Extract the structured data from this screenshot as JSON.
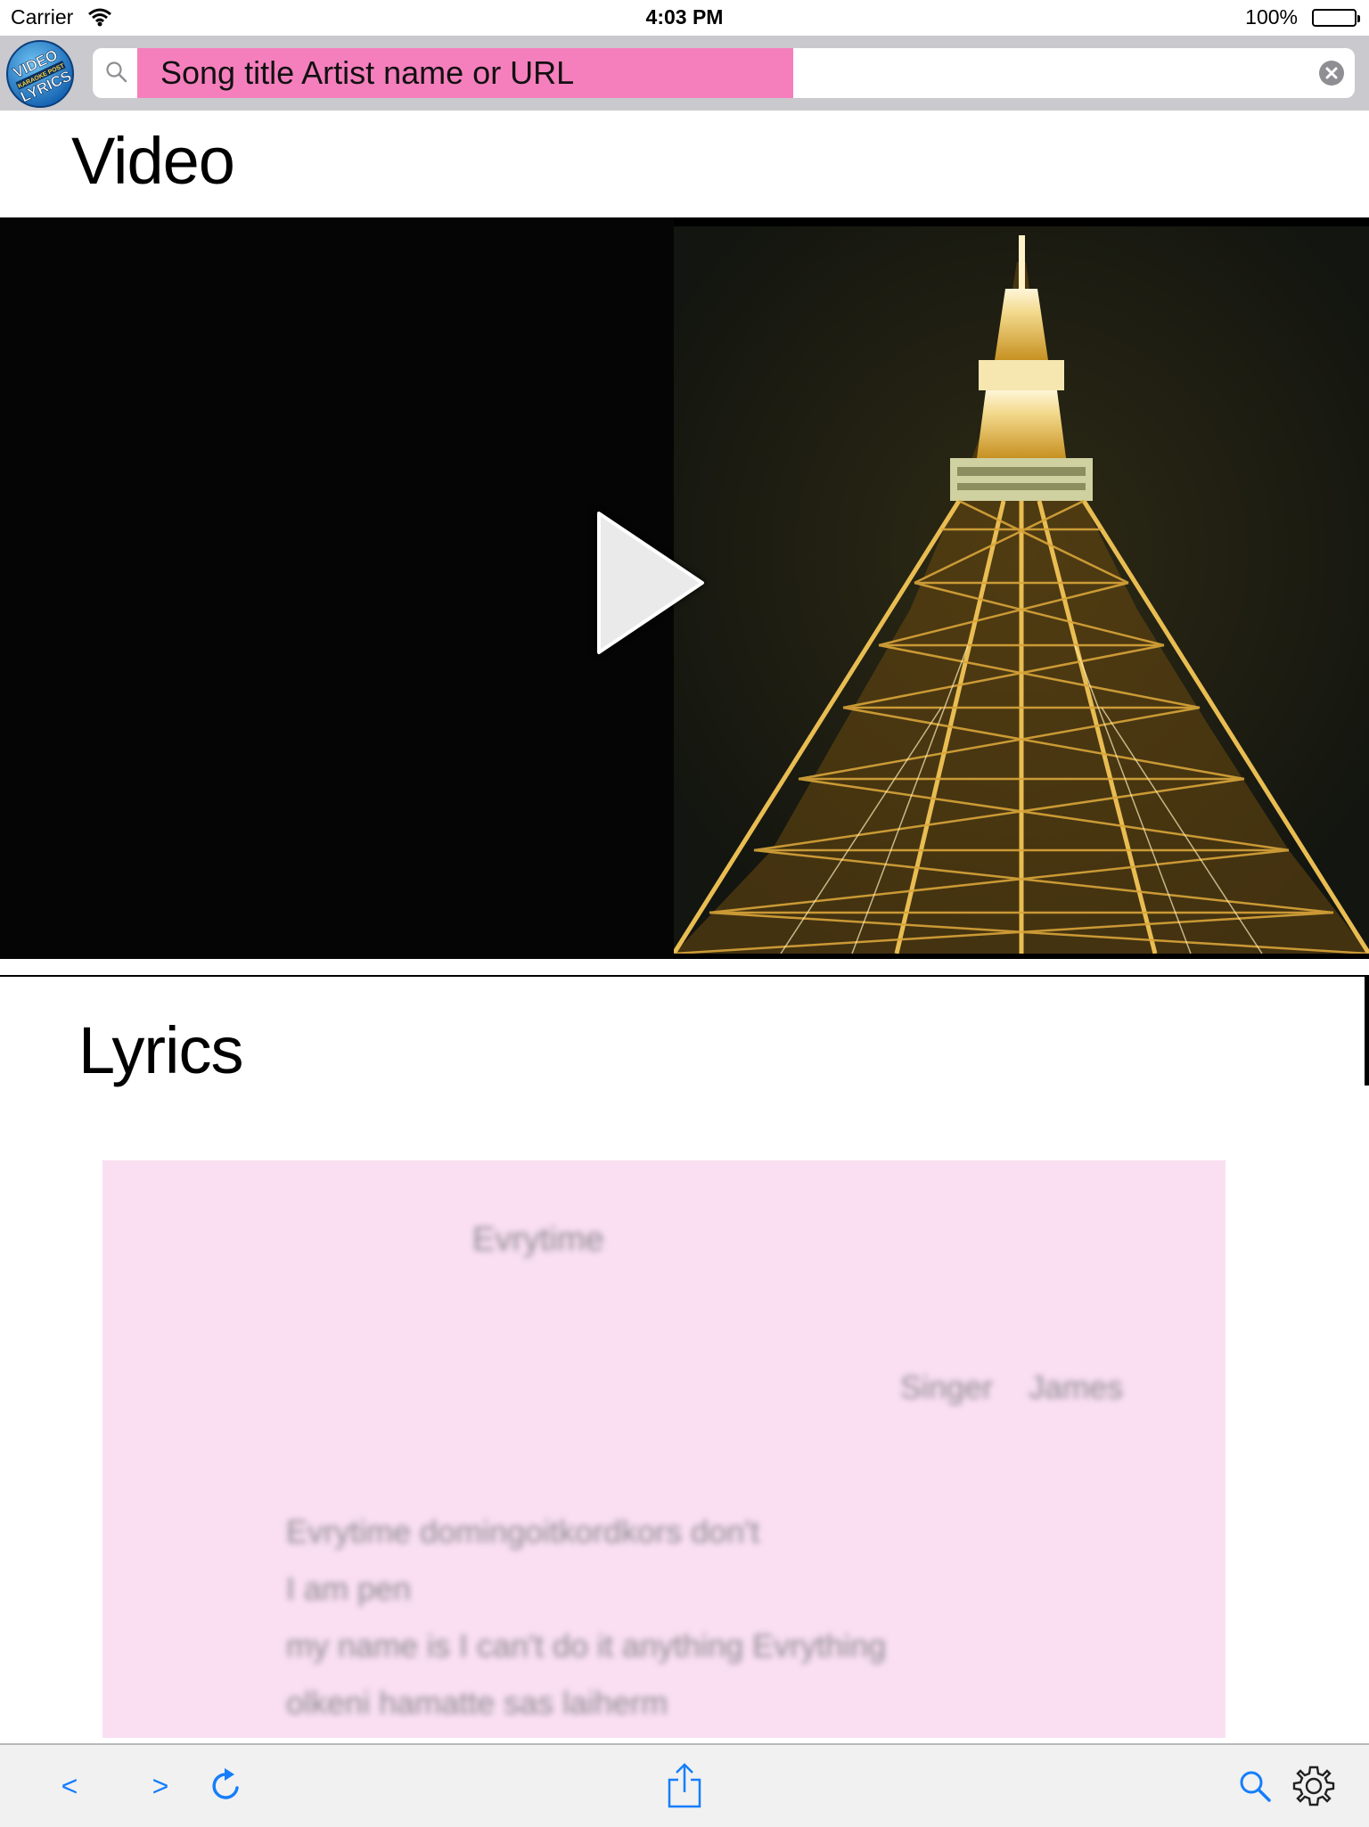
{
  "status_bar": {
    "carrier": "Carrier",
    "time": "4:03 PM",
    "battery": "100%"
  },
  "search": {
    "logo_top": "VIDEO",
    "logo_middle": "KARAOKE POST",
    "logo_bottom": "LYRICS",
    "placeholder": "Song title Artist name or URL"
  },
  "sections": {
    "video_heading": "Video",
    "lyrics_heading": "Lyrics"
  },
  "lyrics": {
    "title": "Evrytime",
    "singer": "Singer    James",
    "lines": [
      "Evrytime domingoitkordkors don't",
      "I am pen",
      "my name is I can't do it anything Evrything",
      "olkeni hamatte sas laiherm"
    ]
  },
  "toolbar": {
    "back": "<",
    "forward": ">"
  },
  "colors": {
    "accent": "#157efb",
    "search_highlight": "#f57fbd",
    "lyrics_background": "#f9dff1",
    "tower_light": "#e8c058"
  }
}
